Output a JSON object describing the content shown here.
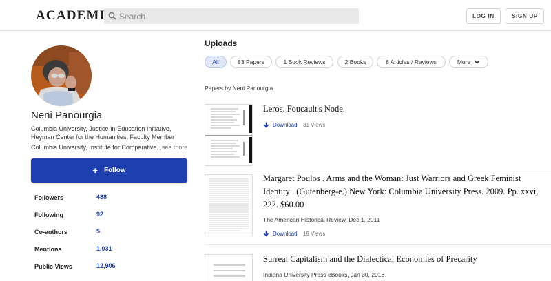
{
  "header": {
    "logo": "ACADEMIA",
    "search_placeholder": "Search",
    "login": "LOG IN",
    "signup": "SIGN UP"
  },
  "profile": {
    "name": "Neni Panourgia",
    "affiliation_line1": "Columbia University, Justice-in-Education Initiative,",
    "affiliation_line2": "Heyman Center for the Humanities, Faculty Member",
    "affiliation_line3": "Columbia University, Institute for Comparative...",
    "see_more": "see more",
    "follow_label": "Follow",
    "stats": [
      {
        "label": "Followers",
        "value": "488"
      },
      {
        "label": "Following",
        "value": "92"
      },
      {
        "label": "Co-authors",
        "value": "5"
      },
      {
        "label": "Mentions",
        "value": "1,031"
      },
      {
        "label": "Public Views",
        "value": "12,906"
      }
    ]
  },
  "main": {
    "heading": "Uploads",
    "tabs": [
      {
        "label": "All"
      },
      {
        "label": "83 Papers"
      },
      {
        "label": "1 Book Reviews"
      },
      {
        "label": "2 Books"
      },
      {
        "label": "8 Articles / Reviews"
      },
      {
        "label": "More"
      }
    ],
    "subheading": "Papers by Neni Panourgia",
    "papers": [
      {
        "title": "Leros. Foucault's Node.",
        "download": "Download",
        "views": "31 Views"
      },
      {
        "title": "Margaret Poulos . Arms and the Woman: Just Warriors and Greek Feminist Identity . (Gutenberg-e.) New York: Columbia University Press. 2009. Pp. xxvi, 222. $60.00",
        "publication": "The American Historical Review, Dec 1, 2011",
        "download": "Download",
        "views": "19 Views"
      },
      {
        "title": "Surreal Capitalism and the Dialectical Economies of Precarity",
        "publication": "Indiana University Press eBooks, Jan 30, 2018"
      }
    ]
  },
  "colors": {
    "accent": "#1e3fb0",
    "active_tab_bg": "#dfe7f6"
  },
  "icons": {
    "search": "search-icon",
    "follow": "plus-icon",
    "more": "chevron-down-icon",
    "download": "download-arrow-icon"
  }
}
